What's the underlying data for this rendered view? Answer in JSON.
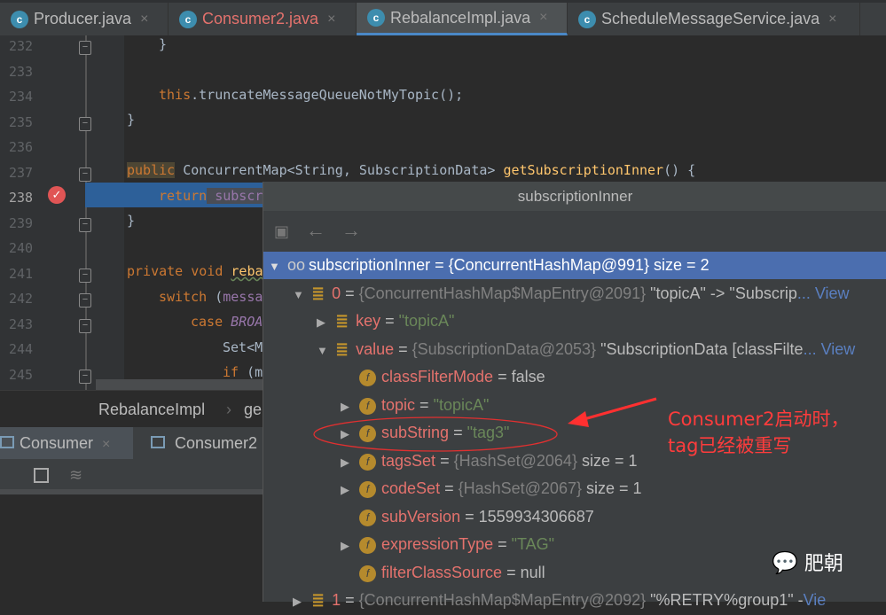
{
  "tabs": [
    {
      "label": "Producer.java",
      "color": "#bbbbbb"
    },
    {
      "label": "Consumer2.java",
      "color": "#e4726d"
    },
    {
      "label": "RebalanceImpl.java",
      "color": "#bbbbbb",
      "active": true
    },
    {
      "label": "ScheduleMessageService.java",
      "color": "#bbbbbb"
    }
  ],
  "tab_close": "×",
  "editor": {
    "line_numbers": [
      "232",
      "233",
      "234",
      "235",
      "236",
      "237",
      "238",
      "239",
      "240",
      "241",
      "242",
      "243",
      "244",
      "245"
    ],
    "current_line": "238",
    "code": {
      "l232": "}",
      "l234_this": "this",
      "l234_rest": ".truncateMessageQueueNotMyTopic();",
      "l235": "}",
      "l237_kw": "public",
      "l237_type": " ConcurrentMap<String, SubscriptionData> ",
      "l237_fn": "getSubscriptionInner",
      "l237_end": "() {",
      "l238_kw": "return",
      "l238_fld": " subscr",
      "l239": "}",
      "l241_kw": "private void ",
      "l241_fn": "reba",
      "l242_kw": "switch",
      "l242_rest": " (",
      "l242_fld": "messa",
      "l243_kw": "case ",
      "l243_it": "BROA",
      "l244": "Set<M",
      "l245_kw": "if",
      "l245_rest": " (m"
    }
  },
  "breadcrumb": {
    "items": [
      "RebalanceImpl",
      "ge"
    ],
    "sep": "›"
  },
  "run_tabs": [
    {
      "label": "Consumer"
    },
    {
      "label": "Consumer2"
    }
  ],
  "popup": {
    "title": "subscriptionInner",
    "rows": [
      {
        "name": "subscriptionInner",
        "eq": " = ",
        "ref": "{ConcurrentHashMap@991}",
        "val": "  size = 2"
      },
      {
        "name": "0",
        "ref": "{ConcurrentHashMap$MapEntry@2091}",
        "val": " \"topicA\" -> \"Subscrip",
        "more": "... View"
      },
      {
        "name": "key",
        "str": "\"topicA\""
      },
      {
        "name": "value",
        "ref": "{SubscriptionData@2053}",
        "val": " \"SubscriptionData [classFilte",
        "more": "... View"
      },
      {
        "name": "classFilterMode",
        "val": "false"
      },
      {
        "name": "topic",
        "str": "\"topicA\""
      },
      {
        "name": "subString",
        "str": "\"tag3\""
      },
      {
        "name": "tagsSet",
        "ref": "{HashSet@2064}",
        "val": "  size = 1"
      },
      {
        "name": "codeSet",
        "ref": "{HashSet@2067}",
        "val": "  size = 1"
      },
      {
        "name": "subVersion",
        "val": "1559934306687"
      },
      {
        "name": "expressionType",
        "str": "\"TAG\""
      },
      {
        "name": "filterClassSource",
        "val": "null"
      },
      {
        "name": "1",
        "ref": "{ConcurrentHashMap$MapEntry@2092}",
        "val": " \"%RETRY%group1\" -",
        "more": "Vie"
      }
    ]
  },
  "annotation": {
    "line1": "Consumer2启动时，",
    "line2": "tag已经被重写",
    "color": "#ff3c3c"
  },
  "watermark": {
    "text": "肥朝"
  },
  "colors": {
    "accent": "#4b6eaf",
    "breakpoint": "#e05555",
    "selection": "#2d6099"
  }
}
